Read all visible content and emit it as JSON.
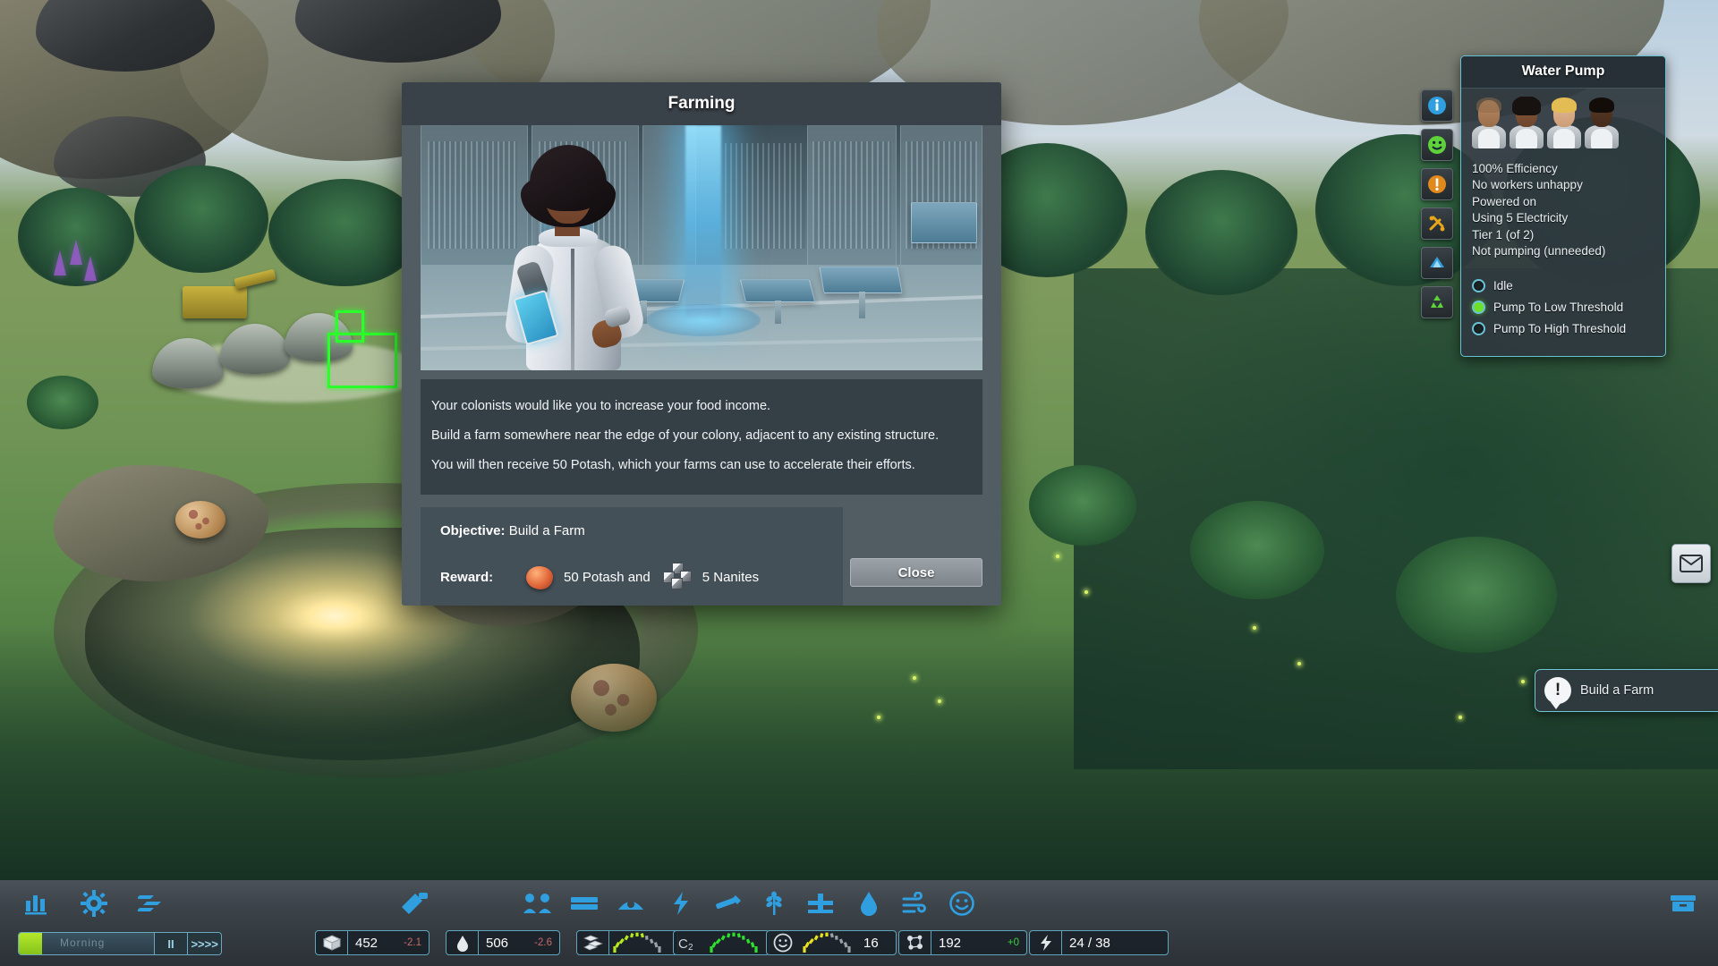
{
  "modal": {
    "title": "Farming",
    "paragraphs": [
      "Your colonists would like you to increase your food income.",
      "Build a farm somewhere near the edge of your colony, adjacent to any existing structure.",
      "You will then receive 50 Potash, which your farms can use to accelerate their efforts."
    ],
    "objective_label": "Objective:",
    "objective_value": "Build a Farm",
    "reward_label": "Reward:",
    "reward_1": "50 Potash and",
    "reward_2": "5 Nanites",
    "close_label": "Close"
  },
  "water_pump": {
    "title": "Water Pump",
    "status": [
      "100% Efficiency",
      "No workers unhappy",
      "Powered on",
      "Using 5 Electricity",
      "Tier 1 (of 2)",
      "Not pumping (unneeded)"
    ],
    "modes": [
      {
        "label": "Idle",
        "selected": false
      },
      {
        "label": "Pump To Low Threshold",
        "selected": true
      },
      {
        "label": "Pump To High Threshold",
        "selected": false
      }
    ],
    "accent_border": "#66c3d0",
    "selected_color": "#6ee02a"
  },
  "notification": {
    "label": "Build a Farm",
    "icon": "alert-exclamation-icon"
  },
  "icon_rail": [
    {
      "name": "info-icon",
      "glyph": "i",
      "color": "#2f9fe0"
    },
    {
      "name": "happiness-icon",
      "glyph": "☺",
      "color": "#5fd13a"
    },
    {
      "name": "alert-icon",
      "glyph": "!",
      "color": "#e08a1e"
    },
    {
      "name": "tools-icon",
      "glyph": "✚",
      "color": "#e8a61a"
    },
    {
      "name": "deposit-icon",
      "glyph": "▲",
      "color": "#2f9fe0"
    },
    {
      "name": "recycle-icon",
      "glyph": "♺",
      "color": "#5fd13a"
    }
  ],
  "mail_button": {
    "name": "mail-icon"
  },
  "bottom_bar": {
    "left_icons": [
      {
        "name": "statistics-icon",
        "glyph": "bars"
      },
      {
        "name": "settings-gear-icon",
        "glyph": "gear"
      },
      {
        "name": "colonists-list-icon",
        "glyph": "people-flow"
      }
    ],
    "center_icons": [
      {
        "name": "build-menu-icon",
        "glyph": "hammer"
      },
      {
        "name": "population-icon",
        "glyph": "people"
      },
      {
        "name": "storage-icon",
        "glyph": "crate"
      },
      {
        "name": "water-icon",
        "glyph": "water-building"
      },
      {
        "name": "power-icon",
        "glyph": "bolt"
      },
      {
        "name": "mining-icon",
        "glyph": "drill"
      },
      {
        "name": "farming-icon",
        "glyph": "wheat"
      },
      {
        "name": "factory-icon",
        "glyph": "factory"
      },
      {
        "name": "water-drop-icon",
        "glyph": "drop"
      },
      {
        "name": "oxygen-icon",
        "glyph": "wind"
      },
      {
        "name": "happiness-face-icon",
        "glyph": "smile"
      }
    ],
    "right_icon": {
      "name": "save-load-icon",
      "glyph": "archive"
    },
    "time": {
      "paused": true,
      "pause_label": "II",
      "fast_label": ">>>>",
      "progress_text": "Morning"
    },
    "resources": [
      {
        "name": "food-resource",
        "icon": "crate-icon",
        "value": "452",
        "delta": "-2.1",
        "delta_sign": "neg"
      },
      {
        "name": "water-resource",
        "icon": "drop-icon",
        "value": "506",
        "delta": "-2.6",
        "delta_sign": "neg"
      },
      {
        "name": "storage-resource",
        "icon": "storage-icon",
        "gauge": 62,
        "gauge_color": "#b6e81f"
      },
      {
        "name": "oxygen-resource",
        "icon": "o2-icon",
        "gauge": 100,
        "gauge_color": "#2ee02e"
      },
      {
        "name": "happiness-resource",
        "icon": "smile-icon",
        "gauge": 52,
        "gauge_color": "#e8e21f",
        "value": "16"
      },
      {
        "name": "nanites-resource",
        "icon": "nanite-icon",
        "value": "192",
        "delta": "+0",
        "delta_sign": "pos"
      },
      {
        "name": "electricity-resource",
        "icon": "bolt-icon",
        "value": "24 / 38"
      }
    ]
  }
}
